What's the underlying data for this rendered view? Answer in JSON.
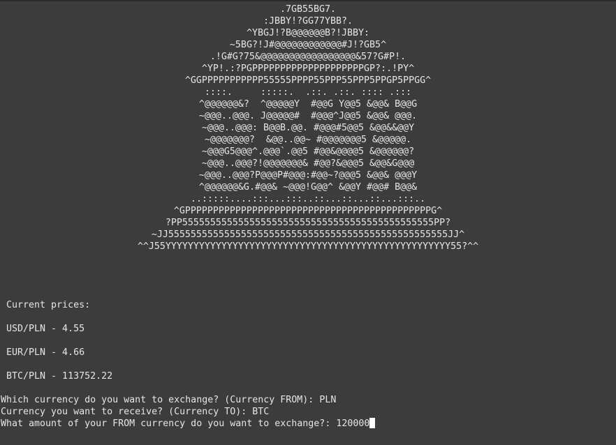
{
  "banner_art": [
    ".7GB55BG7.",
    ":JBBY!?GG77YBB?.",
    "^YBGJ!?B@@@@@@B?!JBBY:",
    "~5BG?!J#@@@@@@@@@@@@#J!?GB5^",
    ".!G#G?75&@@@@@@@@@@@@@@@@@&57?G#P!.",
    "^YP!.:?PGPPPPPPPPPPPPPPPPPPPPGP?:.!PY^",
    "^GGPPPPPPPPPPP55555PPPP55PPP55PPP5PPGP5PPGG^",
    "::::.     :::::.  .::. .::. :::: .:::",
    "^@@@@@@&?  ^@@@@@Y  #@@G Y@@5 &@@& B@@G",
    "~@@@..@@@. J@@@@@#  #@@@^J@@5 &@@& @@@.",
    "~@@@..@@@: B@@B.@@. #@@@#5@@5 &@@&&@@Y",
    "~@@@@@@@?  &@@..@@~ #@@@@@@@5 &@@@@@.",
    "~@@@G5@@@^.@@@`.@@5 #@@&@@@@5 &@@@@@@?",
    "~@@@..@@@?!@@@@@@@& #@@?&@@@5 &@@&G@@@",
    "~@@@..@@@?P@@@P#@@@:#@@~?@@@5 &@@& @@@Y",
    "^@@@@@@&G.#@@& ~@@@!G@@^ &@@Y #@@# B@@&",
    "..:::::....:::...:::..::...::...::...:::..",
    "^GPPPPPPPPPPPPPPPPPPPPPPPPPPPPPPPPPPPPPPPPPPPPG^",
    "?PP555555555555555555555555555555555555555555555PP?",
    "~JJ55555555555555555555555555555555555555555555555555JJ^",
    "^^J55YYYYYYYYYYYYYYYYYYYYYYYYYYYYYYYYYYYYYYYYYYYYYYYYYYY55?^^"
  ],
  "prices": {
    "heading": " Current prices:",
    "usd": " USD/PLN - 4.55",
    "eur": " EUR/PLN - 4.66",
    "btc": " BTC/PLN - 113752.22"
  },
  "prompts": {
    "from_question": "Which currency do you want to exchange? (Currency FROM): ",
    "from_answer": "PLN",
    "to_question": "Currency you want to receive? (Currency TO): ",
    "to_answer": "BTC",
    "amount_question": "What amount of your FROM currency do you want to exchange?: ",
    "amount_input": "120000"
  },
  "colors": {
    "background": "#3c3c3c",
    "text": "#e6e6e6",
    "cursor": "#ffffff"
  }
}
